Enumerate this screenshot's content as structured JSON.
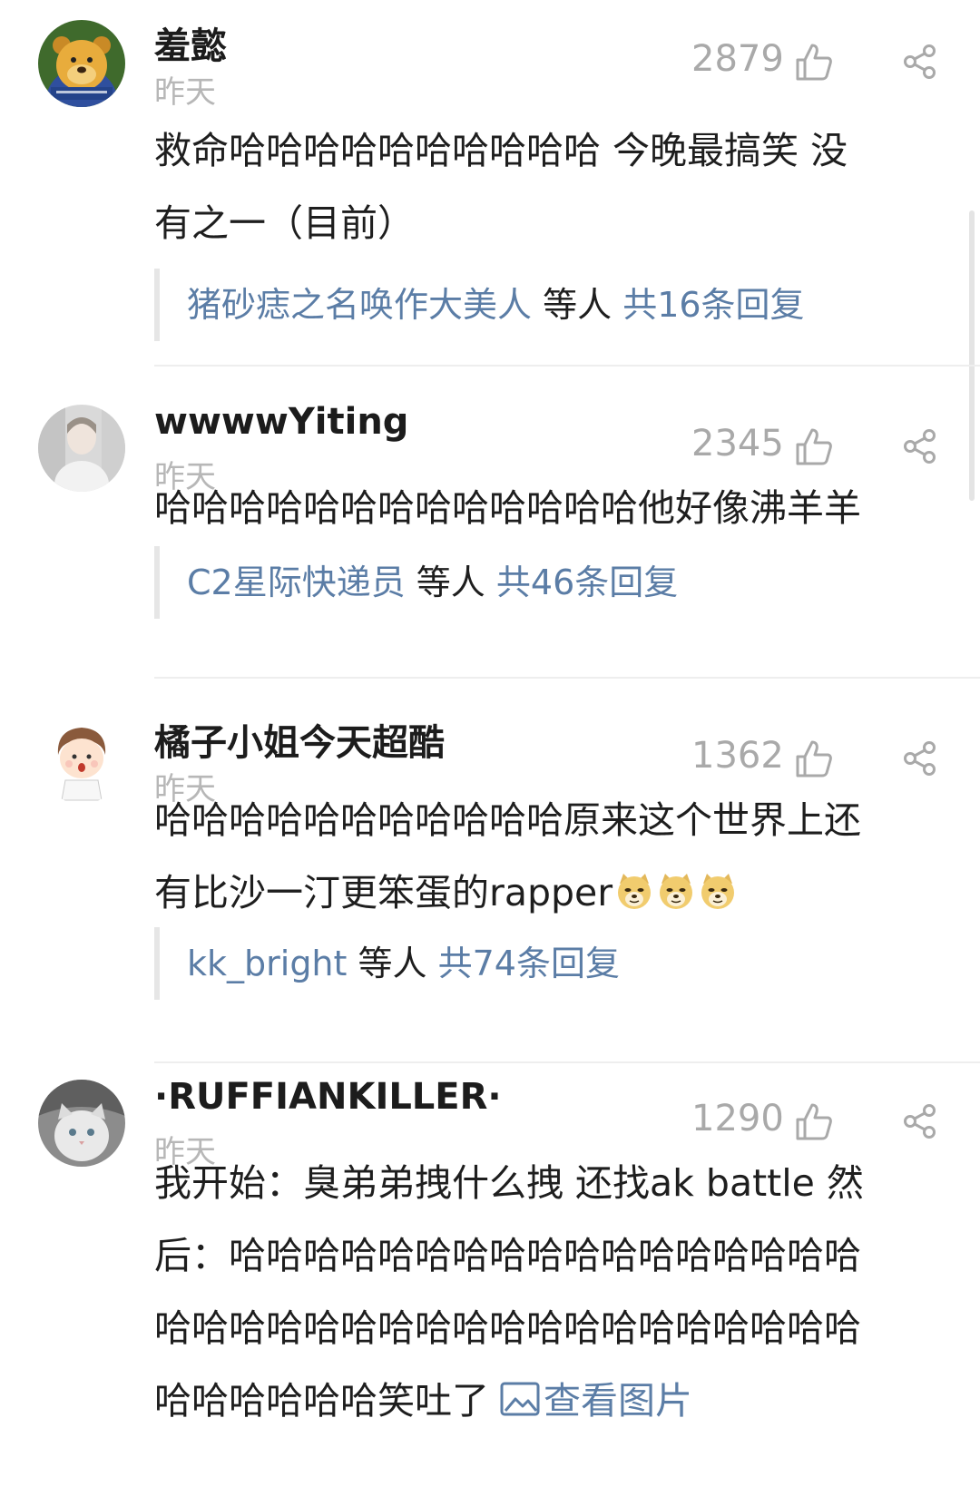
{
  "comments": [
    {
      "username": "羞懿",
      "time": "昨天",
      "likes": "2879",
      "avatar": "winnie-the-pooh-avatar",
      "lines": [
        "救命哈哈哈哈哈哈哈哈哈哈 今晚最搞笑 没",
        "有之一（目前）"
      ],
      "reply": {
        "names": "猪砂痣之名唤作大美人",
        "etc": " 等人 ",
        "count": "共16条回复"
      }
    },
    {
      "username": "wwwwYiting",
      "time": "昨天",
      "likes": "2345",
      "avatar": "portrait-photo-avatar",
      "lines": [
        "哈哈哈哈哈哈哈哈哈哈哈哈哈他好像沸羊羊"
      ],
      "reply": {
        "names": "C2星际快递员",
        "etc": " 等人 ",
        "count": "共46条回复"
      }
    },
    {
      "username": "橘子小姐今天超酷",
      "time": "昨天",
      "likes": "1362",
      "avatar": "cartoon-boy-avatar",
      "lines": [
        "哈哈哈哈哈哈哈哈哈哈哈原来这个世界上还",
        "有比沙一汀更笨蛋的rapper"
      ],
      "emoji": "doge-emoji",
      "reply": {
        "names": "kk_bright",
        "etc": " 等人 ",
        "count": "共74条回复"
      }
    },
    {
      "username": "·RUFFIANKILLER·",
      "time": "昨天",
      "likes": "1290",
      "avatar": "cat-photo-avatar",
      "lines": [
        "我开始：臭弟弟拽什么拽 还找ak battle 然",
        "后：哈哈哈哈哈哈哈哈哈哈哈哈哈哈哈哈哈",
        "哈哈哈哈哈哈哈哈哈哈哈哈哈哈哈哈哈哈哈",
        "哈哈哈哈哈哈笑吐了"
      ],
      "view_image": "查看图片"
    }
  ],
  "colors": {
    "link": "#5b7da6",
    "muted": "#a9a9a9",
    "divider": "#eeeeee"
  },
  "icons": {
    "like": "thumbs-up-icon",
    "share": "share-icon",
    "image": "image-icon"
  }
}
